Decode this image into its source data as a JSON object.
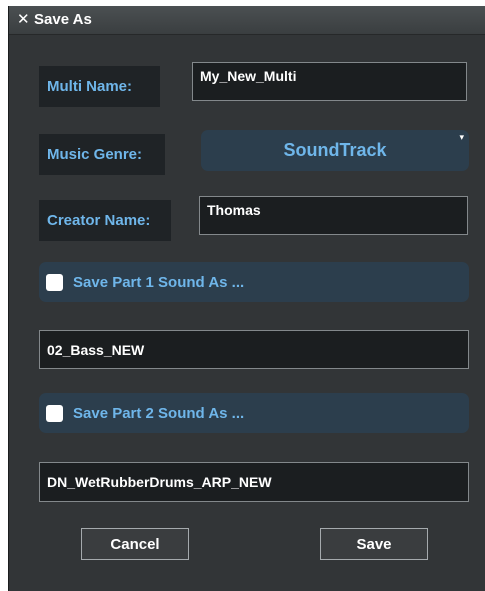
{
  "dialog": {
    "title": "Save As",
    "close_icon": "close-icon (×)"
  },
  "fields": {
    "multi_name": {
      "label": "Multi Name:",
      "value": "My_New_Multi"
    },
    "music_genre": {
      "label": "Music Genre:",
      "selected": "SoundTrack"
    },
    "creator_name": {
      "label": "Creator Name:",
      "value": "Thomas"
    }
  },
  "parts": [
    {
      "label": "Save Part 1 Sound As ...",
      "checked": false,
      "sound_name": "02_Bass_NEW"
    },
    {
      "label": "Save Part 2 Sound As ...",
      "checked": false,
      "sound_name": "DN_WetRubberDrums_ARP_NEW"
    }
  ],
  "buttons": {
    "cancel": "Cancel",
    "save": "Save"
  },
  "colors": {
    "background": "#323537",
    "label_text": "#6fb6ea",
    "panel_accent": "#2c3e4d",
    "field_border": "#83888b"
  }
}
